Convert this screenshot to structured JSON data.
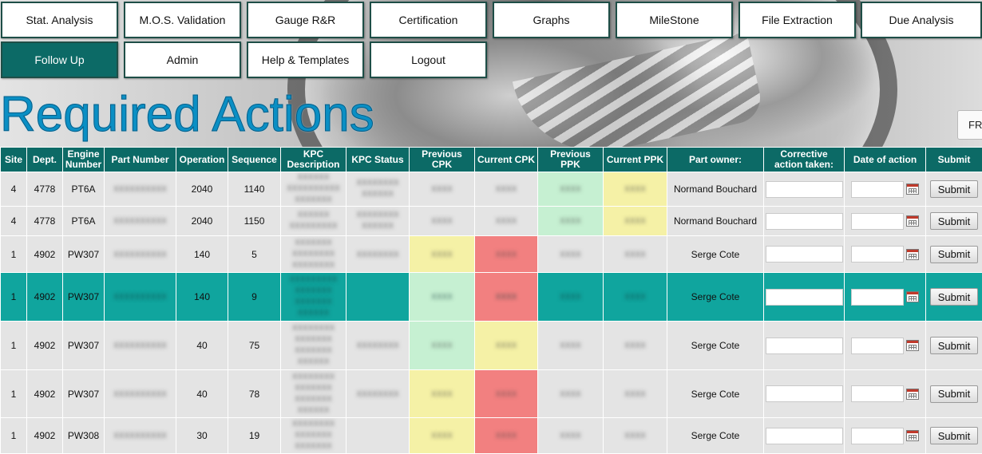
{
  "nav": {
    "items": [
      {
        "label": "Stat. Analysis",
        "active": false
      },
      {
        "label": "M.O.S. Validation",
        "active": false
      },
      {
        "label": "Gauge R&R",
        "active": false
      },
      {
        "label": "Certification",
        "active": false
      },
      {
        "label": "Graphs",
        "active": false
      },
      {
        "label": "MileStone",
        "active": false
      },
      {
        "label": "File Extraction",
        "active": false
      },
      {
        "label": "Due Analysis",
        "active": false
      },
      {
        "label": "Follow Up",
        "active": true
      },
      {
        "label": "Admin",
        "active": false
      },
      {
        "label": "Help & Templates",
        "active": false
      },
      {
        "label": "Logout",
        "active": false
      }
    ]
  },
  "page": {
    "title": "Required Actions",
    "lang_button": "FR"
  },
  "table": {
    "columns": [
      "Site",
      "Dept.",
      "Engine Number",
      "Part Number",
      "Operation",
      "Sequence",
      "KPC Description",
      "KPC Status",
      "Previous CPK",
      "Current CPK",
      "Previous PPK",
      "Current PPK",
      "Part owner:",
      "Corrective action taken:",
      "Date of action",
      "Submit"
    ],
    "submit_label": "Submit",
    "rows": [
      {
        "site": "4",
        "dept": "4778",
        "engine": "PT6A",
        "operation": "2040",
        "sequence": "1140",
        "owner": "Normand Bouchard",
        "prev_cpk_status": "none",
        "cur_cpk_status": "none",
        "prev_ppk_status": "green",
        "cur_ppk_status": "yellow",
        "selected": false
      },
      {
        "site": "4",
        "dept": "4778",
        "engine": "PT6A",
        "operation": "2040",
        "sequence": "1150",
        "owner": "Normand Bouchard",
        "prev_cpk_status": "none",
        "cur_cpk_status": "none",
        "prev_ppk_status": "green",
        "cur_ppk_status": "yellow",
        "selected": false
      },
      {
        "site": "1",
        "dept": "4902",
        "engine": "PW307",
        "operation": "140",
        "sequence": "5",
        "owner": "Serge Cote",
        "prev_cpk_status": "yellow",
        "cur_cpk_status": "red",
        "prev_ppk_status": "none",
        "cur_ppk_status": "none",
        "selected": false
      },
      {
        "site": "1",
        "dept": "4902",
        "engine": "PW307",
        "operation": "140",
        "sequence": "9",
        "owner": "Serge Cote",
        "prev_cpk_status": "green",
        "cur_cpk_status": "red",
        "prev_ppk_status": "none",
        "cur_ppk_status": "none",
        "selected": true
      },
      {
        "site": "1",
        "dept": "4902",
        "engine": "PW307",
        "operation": "40",
        "sequence": "75",
        "owner": "Serge Cote",
        "prev_cpk_status": "green",
        "cur_cpk_status": "yellow",
        "prev_ppk_status": "none",
        "cur_ppk_status": "none",
        "selected": false
      },
      {
        "site": "1",
        "dept": "4902",
        "engine": "PW307",
        "operation": "40",
        "sequence": "78",
        "owner": "Serge Cote",
        "prev_cpk_status": "yellow",
        "cur_cpk_status": "red",
        "prev_ppk_status": "none",
        "cur_ppk_status": "none",
        "selected": false
      },
      {
        "site": "1",
        "dept": "4902",
        "engine": "PW308",
        "operation": "30",
        "sequence": "19",
        "owner": "Serge Cote",
        "prev_cpk_status": "yellow",
        "cur_cpk_status": "red",
        "prev_ppk_status": "none",
        "cur_ppk_status": "none",
        "selected": false
      }
    ]
  },
  "colors": {
    "header_bg": "#0c6a66",
    "selected_row": "#10a59e",
    "title": "#0a8fc4",
    "green": "#c6f0d2",
    "yellow": "#f5f1a6",
    "red": "#f28080"
  }
}
